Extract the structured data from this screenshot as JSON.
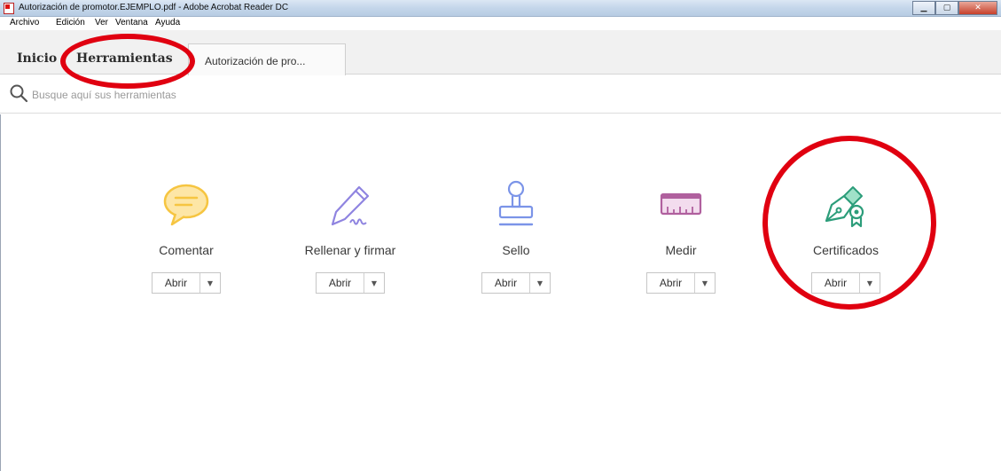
{
  "window": {
    "title": "Autorización de promotor.EJEMPLO.pdf - Adobe Acrobat Reader DC"
  },
  "menubar": {
    "items": [
      "Archivo",
      "Edición",
      "Ver",
      "Ventana",
      "Ayuda"
    ]
  },
  "tabs": {
    "inicio": "Inicio",
    "herramientas": "Herramientas",
    "document": "Autorización de pro..."
  },
  "search": {
    "placeholder": "Busque aquí sus herramientas"
  },
  "tools": [
    {
      "label": "Comentar",
      "open": "Abrir",
      "icon": "comment-icon",
      "color": "#f6c541"
    },
    {
      "label": "Rellenar y firmar",
      "open": "Abrir",
      "icon": "fill-sign-icon",
      "color": "#8f84e0"
    },
    {
      "label": "Sello",
      "open": "Abrir",
      "icon": "stamp-icon",
      "color": "#7b94e8"
    },
    {
      "label": "Medir",
      "open": "Abrir",
      "icon": "ruler-icon",
      "color": "#b0609e"
    },
    {
      "label": "Certificados",
      "open": "Abrir",
      "icon": "certificate-pen-icon",
      "color": "#2c9d7a"
    }
  ],
  "annotations": {
    "color": "#e00010"
  }
}
